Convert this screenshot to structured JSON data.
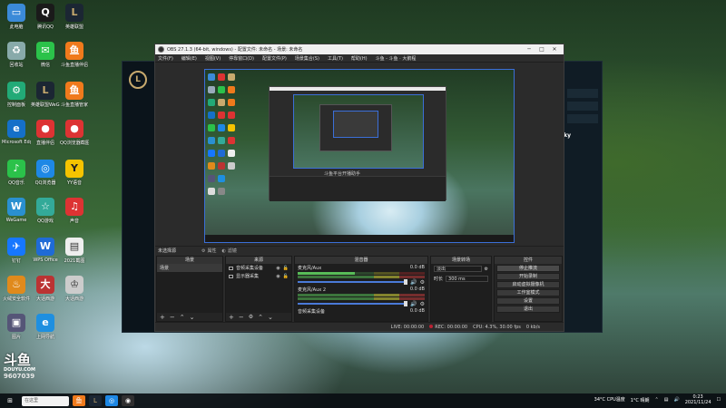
{
  "obs": {
    "title": "OBS 27.1.3 (64-bit, windows) - 配置文件: 未命名 - 场景: 未命名",
    "menus": [
      "文件(F)",
      "编辑(E)",
      "视图(V)",
      "停靠窗口(D)",
      "配置文件(P)",
      "场景集合(S)",
      "工具(T)",
      "帮助(H)",
      "斗鱼 - 斗鱼 · 大鹅程"
    ],
    "preview_inner_label": "斗鱼平台开播助手",
    "toolbar": {
      "no_selection": "未选择源",
      "properties": "属性",
      "filters": "滤镜"
    },
    "docks": {
      "scenes": {
        "title": "场景",
        "items": [
          "场景"
        ]
      },
      "sources": {
        "title": "来源",
        "items": [
          "音频采集设备",
          "显示器采集"
        ]
      },
      "mixer": {
        "title": "混音器",
        "channels": [
          {
            "name": "麦克风/Aux",
            "db": "0.0 dB"
          },
          {
            "name": "麦克风/Aux 2",
            "db": "0.0 dB"
          },
          {
            "name": "音频采集设备",
            "db": "0.0 dB"
          }
        ]
      },
      "transitions": {
        "title": "场景转场",
        "type": "淡出",
        "duration_label": "时长",
        "duration": "300 ms"
      },
      "controls": {
        "title": "控件",
        "buttons": [
          "停止推流",
          "开始录制",
          "启动虚拟摄像机",
          "工作室模式",
          "设置",
          "退出"
        ]
      }
    },
    "status": {
      "live": "LIVE: 00:00:00",
      "rec": "REC: 00:00:00",
      "cpu": "CPU: 4.3%, 30.00 fps",
      "kb": "0 kb/s"
    }
  },
  "desktop": {
    "icons": [
      {
        "label": "此电脑",
        "color": "#3b8ad8",
        "glyph": "▭"
      },
      {
        "label": "回收站",
        "color": "#9ab",
        "glyph": "🗑"
      },
      {
        "label": "控制面板",
        "color": "#2a7",
        "glyph": "⚙"
      },
      {
        "label": "Microsoft Edge",
        "color": "#1570c9",
        "glyph": "e"
      },
      {
        "label": "QQ音乐",
        "color": "#2bc24a",
        "glyph": "♪"
      },
      {
        "label": "WeGame",
        "color": "#2a90d0",
        "glyph": "W"
      },
      {
        "label": "钉钉",
        "color": "#1677ff",
        "glyph": "✈"
      },
      {
        "label": "火绒安全软件",
        "color": "#e08a1c",
        "glyph": "♨"
      },
      {
        "label": "图片",
        "color": "#557",
        "glyph": "▣"
      },
      {
        "label": "腾讯QQ",
        "color": "#1a1a1a",
        "glyph": "Q"
      },
      {
        "label": "微信",
        "color": "#2bc24a",
        "glyph": "✉"
      },
      {
        "label": "英雄联盟WeGame版",
        "color": "#c8aa6e",
        "glyph": "L"
      },
      {
        "label": "直播伴侣",
        "color": "#d33",
        "glyph": "●"
      },
      {
        "label": "QQ浏览器",
        "color": "#1e88e5",
        "glyph": "◎"
      },
      {
        "label": "QQ游戏",
        "color": "#3a9",
        "glyph": "☆"
      },
      {
        "label": "WPS Office",
        "color": "#1f6bd6",
        "glyph": "W"
      },
      {
        "label": "大话西游",
        "color": "#b33",
        "glyph": "大"
      },
      {
        "label": "上网导航",
        "color": "#1e8fe0",
        "glyph": "e"
      },
      {
        "label": "英雄联盟",
        "color": "#c8aa6e",
        "glyph": "L"
      },
      {
        "label": "斗鱼直播伴侣",
        "color": "#f07a1c",
        "glyph": "鱼"
      },
      {
        "label": "斗鱼直播管家",
        "color": "#f07a1c",
        "glyph": "鱼"
      },
      {
        "label": "QQ浏览器截图",
        "color": "#d33",
        "glyph": "●"
      },
      {
        "label": "YY语音",
        "color": "#f5c400",
        "glyph": "Y"
      },
      {
        "label": "声音",
        "color": "#d33",
        "glyph": "♫"
      },
      {
        "label": "2021截图",
        "color": "#eee",
        "glyph": "▤"
      },
      {
        "label": "大话西游",
        "color": "#ccc",
        "glyph": "♔"
      }
    ]
  },
  "lol": {
    "sky_label": "y",
    "sky_label_full": "sky"
  },
  "douyu": {
    "brand": "斗鱼",
    "site": "DOUYU.COM",
    "room": "9607039"
  },
  "taskbar": {
    "search_text": "在这里",
    "weather": "34°C CPU温度",
    "temp": "1°C 晴朗",
    "time": "0:23",
    "date": "2021/11/24"
  }
}
